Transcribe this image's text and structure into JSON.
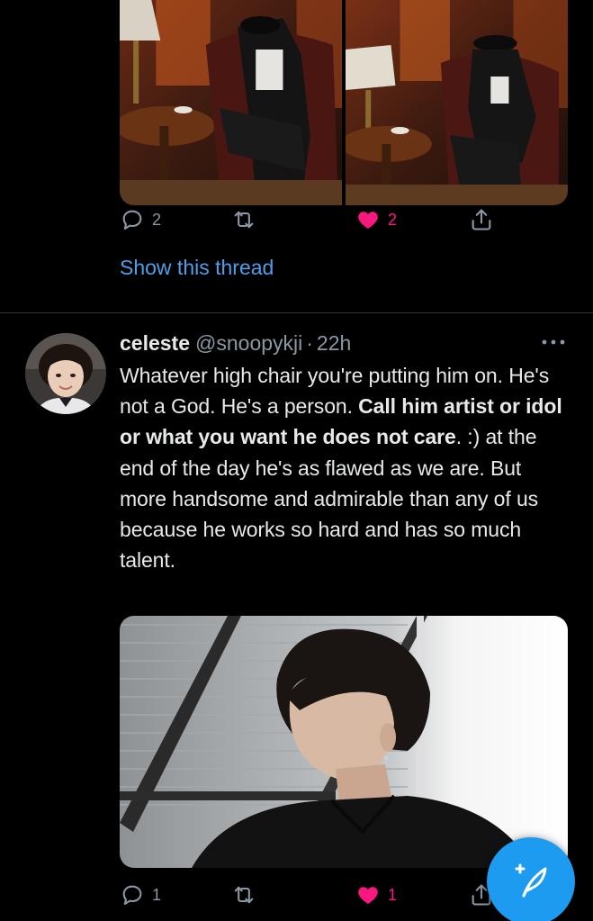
{
  "tweet_1": {
    "media": [
      "photo-armchair-hat-hand",
      "photo-armchair-hat-down"
    ],
    "actions": {
      "reply_count": "2",
      "retweet_count": "",
      "like_count": "2",
      "liked": true
    },
    "thread_link": "Show this thread"
  },
  "tweet_2": {
    "author": {
      "display_name": "celeste",
      "handle": "@snoopykji",
      "time_sep": "·",
      "time": "22h"
    },
    "text_segments": [
      {
        "text": "Whatever high chair you're putting him on. He's not a God. He's a person. ",
        "bold": false
      },
      {
        "text": "Call him artist or idol or what you want he does not care",
        "bold": true
      },
      {
        "text": ". :) at the end of the day he's as flawed as we are. But more handsome and admirable than any of us because he works so hard and has so much talent.",
        "bold": false
      }
    ],
    "media": [
      "photo-portrait-window"
    ],
    "actions": {
      "reply_count": "1",
      "retweet_count": "",
      "like_count": "1",
      "liked": true
    }
  },
  "colors": {
    "background": "#000000",
    "text": "#e7e9ea",
    "muted": "#8b98a5",
    "link": "#4f9fe8",
    "like": "#f91880",
    "fab": "#1d9bf0",
    "divider": "#2f3336"
  },
  "icons": {
    "reply": "reply-icon",
    "retweet": "retweet-icon",
    "like": "heart-icon",
    "share": "share-icon",
    "more": "more-dots-icon",
    "compose": "compose-feather-icon"
  }
}
